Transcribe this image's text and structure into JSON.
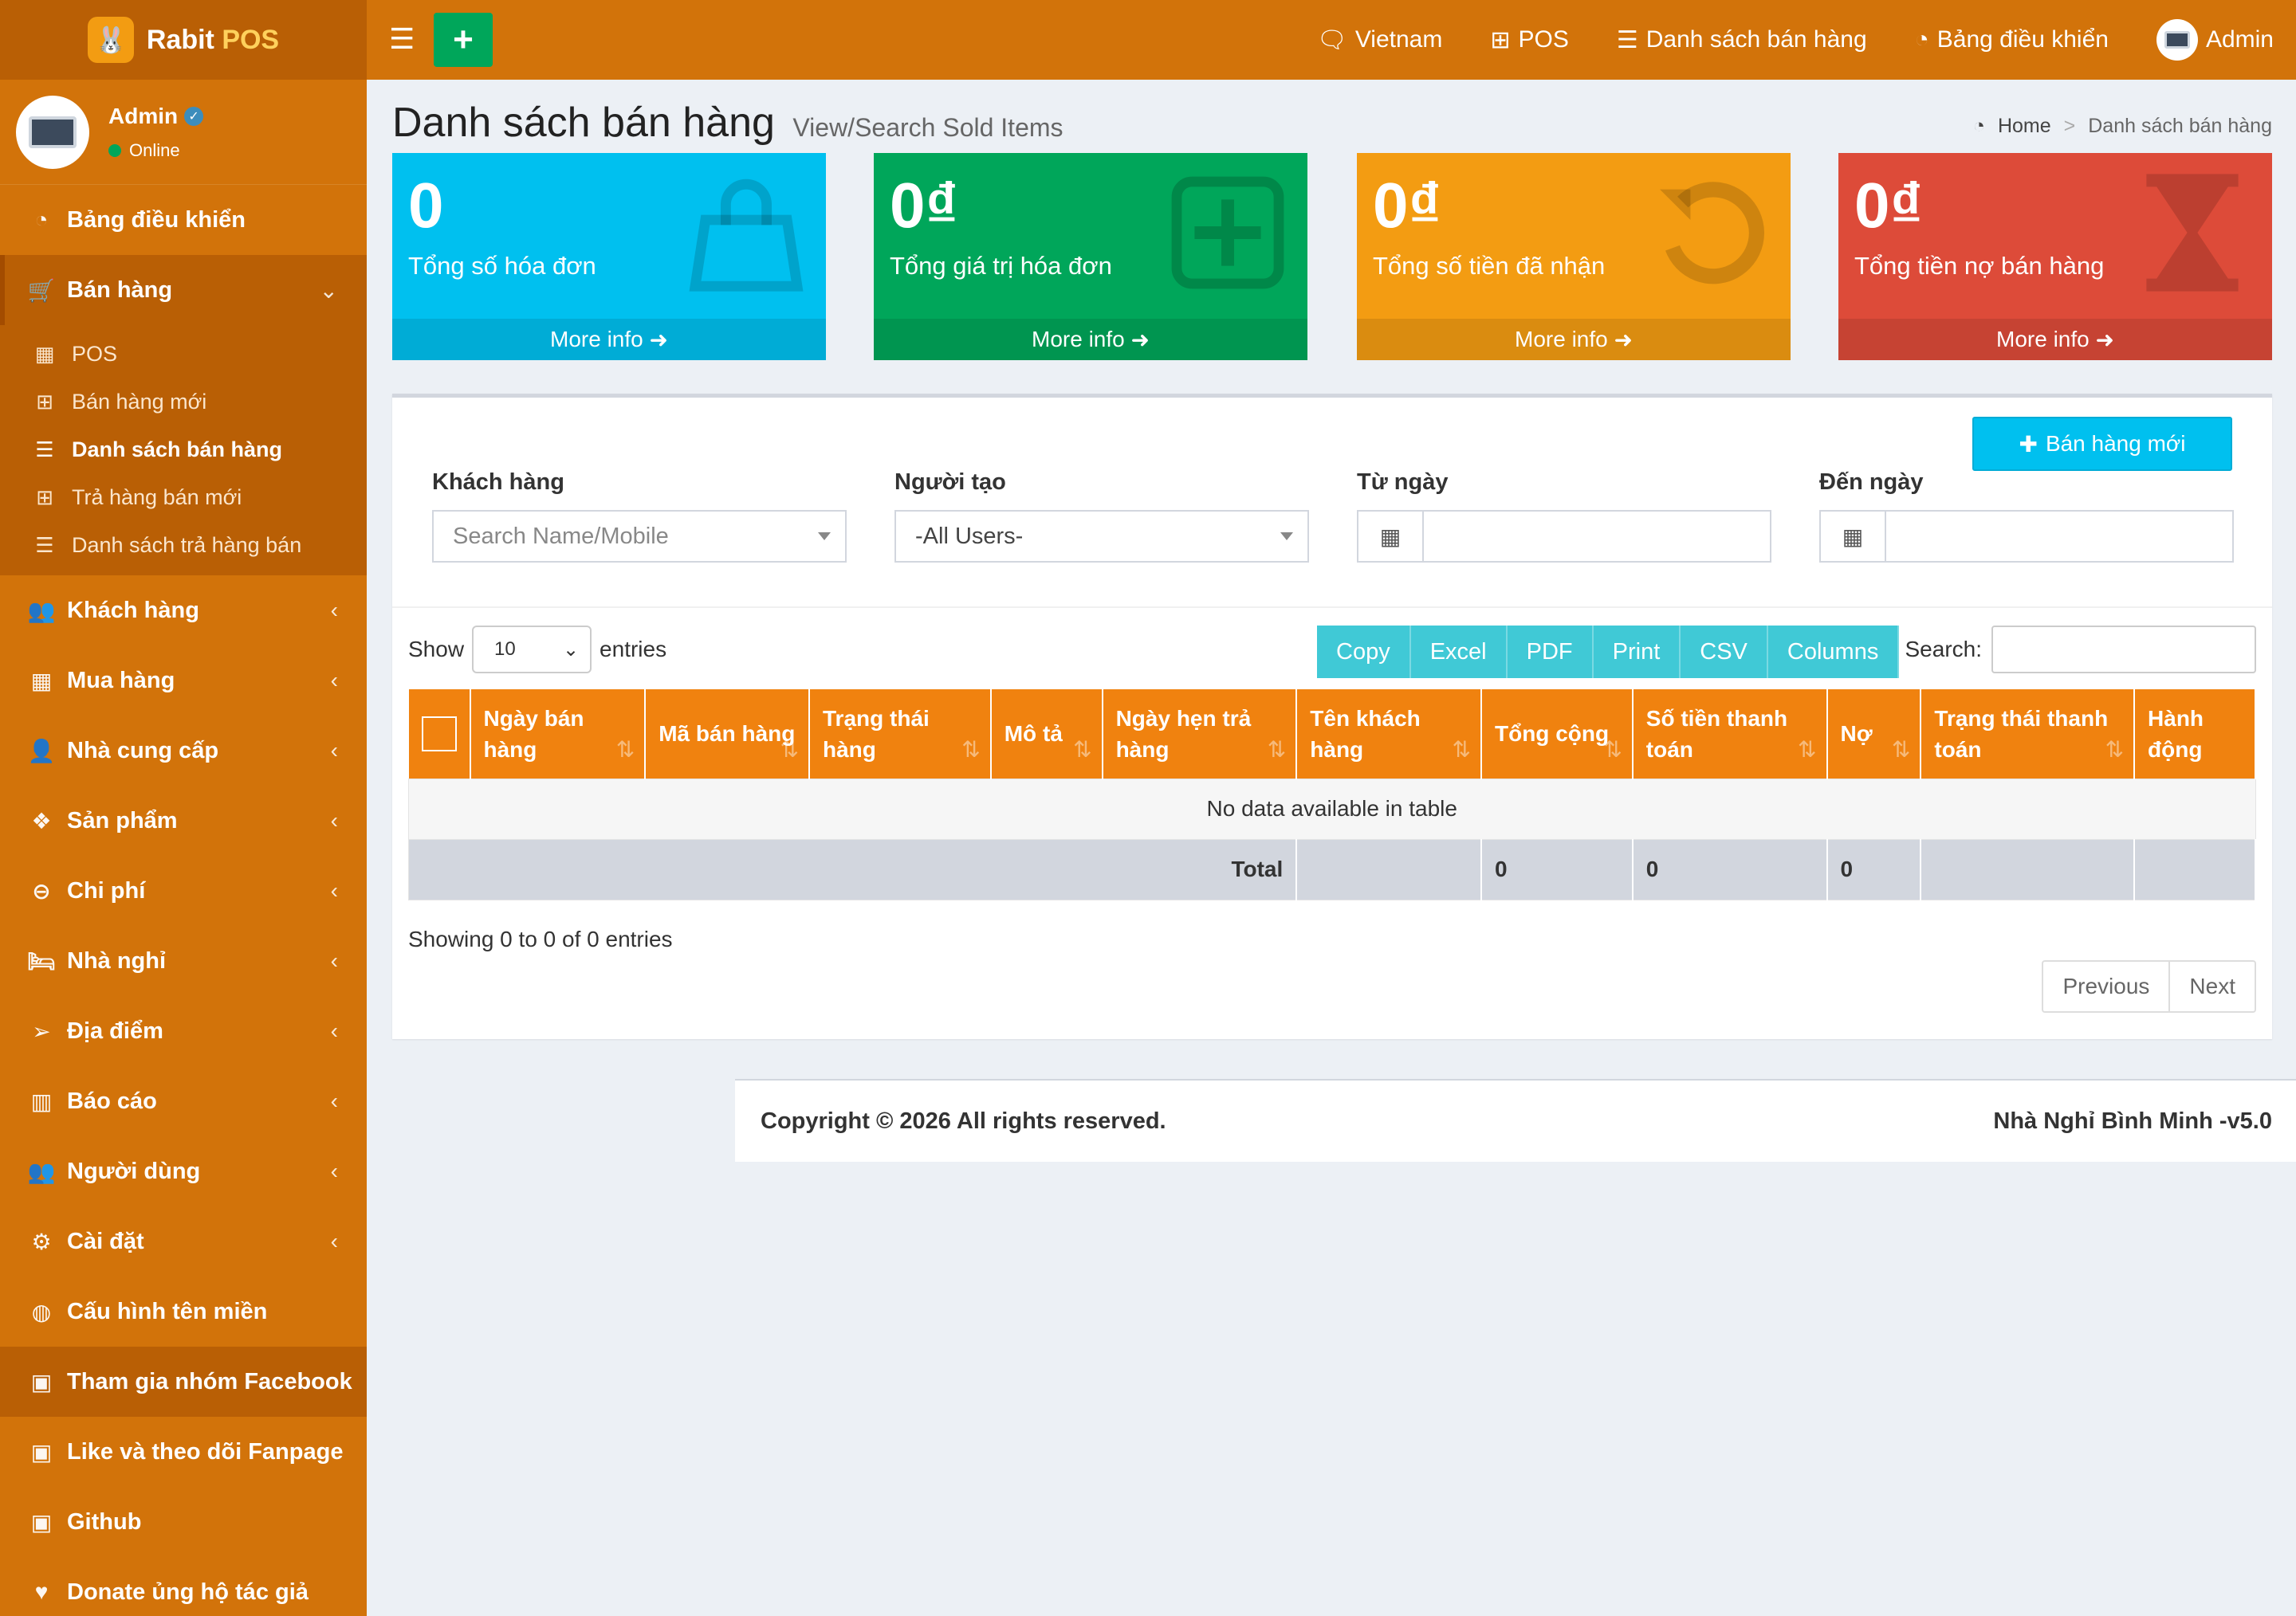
{
  "app": {
    "logo_text_a": "Rabit",
    "logo_text_b": "POS",
    "user_name": "Admin",
    "user_status": "Online"
  },
  "sidebar": {
    "items": [
      {
        "label": "Bảng điều khiển",
        "icon": "dashboard-icon",
        "glyph": "◔"
      },
      {
        "label": "Bán hàng",
        "icon": "cart-icon",
        "glyph": "🛒"
      },
      {
        "label": "Khách hàng",
        "icon": "users-icon",
        "glyph": "👥"
      },
      {
        "label": "Mua hàng",
        "icon": "grid-icon",
        "glyph": "▦"
      },
      {
        "label": "Nhà cung cấp",
        "icon": "user-plus-icon",
        "glyph": "👤"
      },
      {
        "label": "Sản phẩm",
        "icon": "cubes-icon",
        "glyph": "❖"
      },
      {
        "label": "Chi phí",
        "icon": "minus-circle-icon",
        "glyph": "⊖"
      },
      {
        "label": "Nhà nghỉ",
        "icon": "bed-icon",
        "glyph": "🛏"
      },
      {
        "label": "Địa điểm",
        "icon": "paper-plane-icon",
        "glyph": "➢"
      },
      {
        "label": "Báo cáo",
        "icon": "bar-chart-icon",
        "glyph": "▥"
      },
      {
        "label": "Người dùng",
        "icon": "users-icon",
        "glyph": "👥"
      },
      {
        "label": "Cài đặt",
        "icon": "cogs-icon",
        "glyph": "⚙"
      },
      {
        "label": "Cấu hình tên miền",
        "icon": "globe-icon",
        "glyph": "◍"
      },
      {
        "label": "Tham gia nhóm Facebook",
        "icon": "briefcase-icon",
        "glyph": "▣"
      },
      {
        "label": "Like và theo dõi Fanpage",
        "icon": "briefcase-icon",
        "glyph": "▣"
      },
      {
        "label": "Github",
        "icon": "briefcase-icon",
        "glyph": "▣"
      },
      {
        "label": "Donate ủng hộ tác giả",
        "icon": "heart-icon",
        "glyph": "♥"
      }
    ],
    "submenu": [
      {
        "label": "POS",
        "glyph": "▦"
      },
      {
        "label": "Bán hàng mới",
        "glyph": "⊞"
      },
      {
        "label": "Danh sách bán hàng",
        "glyph": "☰"
      },
      {
        "label": "Trả hàng bán mới",
        "glyph": "⊞"
      },
      {
        "label": "Danh sách trả hàng bán",
        "glyph": "☰"
      }
    ]
  },
  "topbar": {
    "links": [
      "Vietnam",
      "POS",
      "Danh sách bán hàng",
      "Bảng điều khiển",
      "Admin"
    ]
  },
  "header": {
    "title": "Danh sách bán hàng",
    "subtitle": "View/Search Sold Items",
    "breadcrumb_home": "Home",
    "breadcrumb_sep": ">",
    "breadcrumb_current": "Danh sách bán hàng"
  },
  "info_boxes": [
    {
      "value": "0",
      "label": "Tổng số hóa đơn",
      "footer": "More info",
      "color": "#00c0ef"
    },
    {
      "value": "0₫",
      "label": "Tổng giá trị hóa đơn",
      "footer": "More info",
      "color": "#00a65a"
    },
    {
      "value": "0₫",
      "label": "Tổng số tiền đã nhận",
      "footer": "More info",
      "color": "#f39c12"
    },
    {
      "value": "0₫",
      "label": "Tổng tiền nợ bán hàng",
      "footer": "More info",
      "color": "#dd4b39"
    }
  ],
  "filters": {
    "new_sale_label": "Bán hàng mới",
    "customer_label": "Khách hàng",
    "customer_placeholder": "Search Name/Mobile",
    "creator_label": "Người tạo",
    "creator_value": "-All Users-",
    "from_label": "Từ ngày",
    "to_label": "Đến ngày"
  },
  "datatable": {
    "show_label": "Show",
    "length_value": "10",
    "entries_label": "entries",
    "buttons": [
      "Copy",
      "Excel",
      "PDF",
      "Print",
      "CSV",
      "Columns"
    ],
    "search_label": "Search:",
    "columns": [
      "Ngày bán hàng",
      "Mã bán hàng",
      "Trạng thái hàng",
      "Mô tả",
      "Ngày hẹn trả hàng",
      "Tên khách hàng",
      "Tổng cộng",
      "Số tiền thanh toán",
      "Nợ",
      "Trạng thái thanh toán",
      "Hành động"
    ],
    "empty_text": "No data available in table",
    "total_label": "Total",
    "total_sum": "0",
    "total_paid": "0",
    "total_due": "0",
    "info_text": "Showing 0 to 0 of 0 entries",
    "prev_label": "Previous",
    "next_label": "Next"
  },
  "footer": {
    "copyright": "Copyright © 2026 All rights reserved.",
    "version": "Nhà Nghỉ Bình Minh -v5.0"
  },
  "colors": {
    "sidebar": "#d2730a",
    "sidebar_dark": "#b95f05",
    "table_header": "#f0820f",
    "dt_button": "#40c9d6"
  }
}
